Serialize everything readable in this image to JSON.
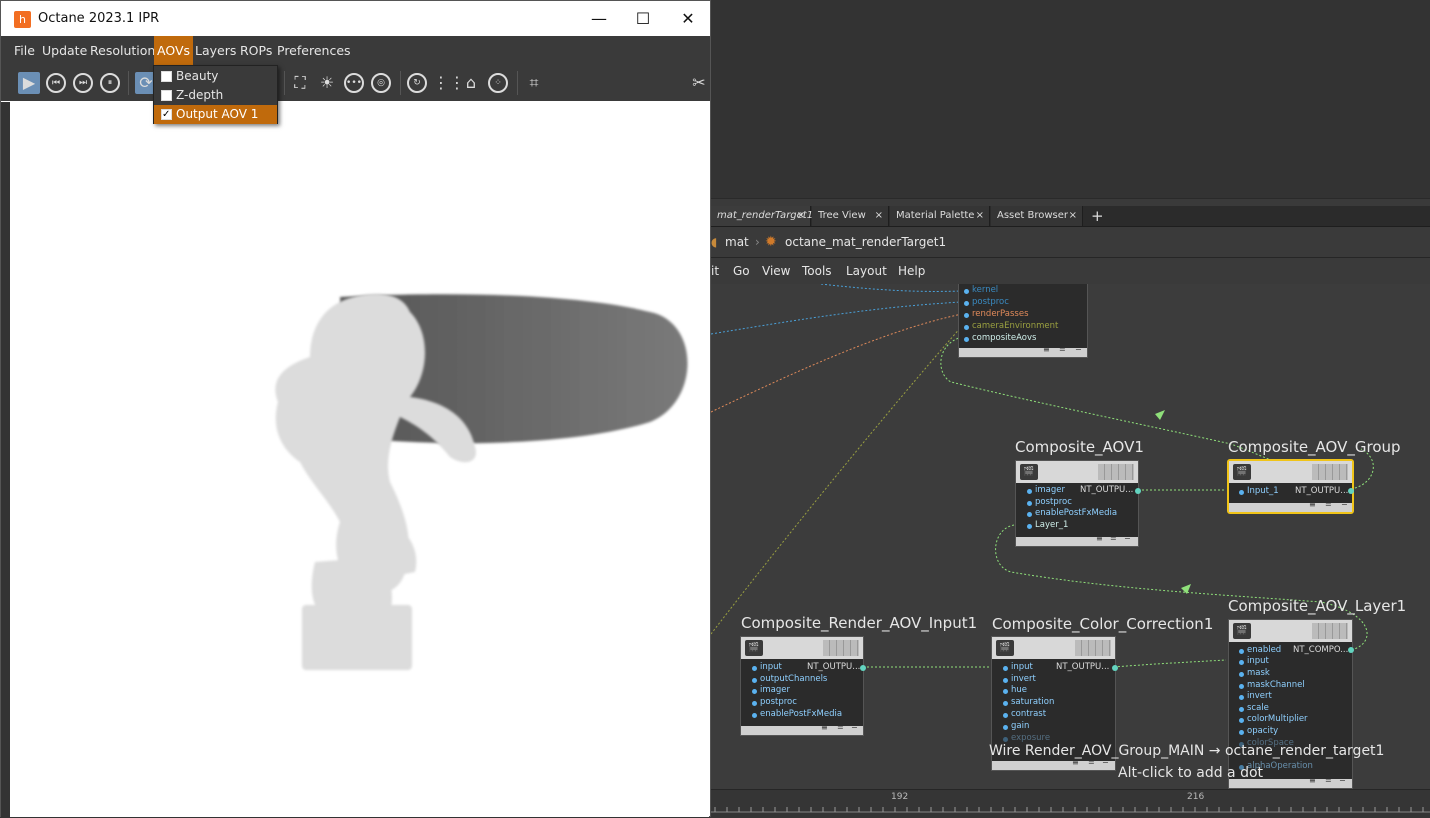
{
  "ipr_window": {
    "title": "Octane 2023.1 IPR",
    "logo_glyph": "h",
    "controls": {
      "minimize": "—",
      "maximize": "☐",
      "close": "✕"
    },
    "menu": [
      "File",
      "Update",
      "Resolution",
      "AOVs",
      "Layers",
      "ROPs",
      "Preferences"
    ],
    "active_menu": "AOVs",
    "aov_menu_items": [
      {
        "label": "Beauty",
        "checked": false
      },
      {
        "label": "Z-depth",
        "checked": false
      },
      {
        "label": "Output AOV 1",
        "checked": true
      }
    ],
    "toolbar_icons": [
      "render-icon",
      "first-frame-icon",
      "next-frame-icon",
      "pause-icon",
      "refresh-icon",
      "focus-picker-icon",
      "light-icon",
      "more-icon",
      "target-icon",
      "spin-icon",
      "grid-icon",
      "home-icon",
      "noise-icon",
      "crop-icon",
      "tools-icon"
    ]
  },
  "houdini": {
    "tabs": [
      {
        "label": "mat_renderTarget1",
        "active": true
      },
      {
        "label": "Tree View",
        "active": false
      },
      {
        "label": "Material Palette",
        "active": false
      },
      {
        "label": "Asset Browser",
        "active": false
      }
    ],
    "tab_add": "+",
    "tab_close": "×",
    "breadcrumb": [
      "mat",
      "octane_mat_renderTarget1"
    ],
    "menu": [
      "it",
      "Go",
      "View",
      "Tools",
      "Layout",
      "Help"
    ],
    "ruler_labels": [
      "192",
      "216"
    ],
    "hint_line1": "Wire Render_AOV_Group_MAIN → octane_render_target1",
    "hint_line2": "Alt-click to add a dot"
  },
  "nodes": {
    "render_target": {
      "ports": [
        "kernel",
        "postproc",
        "renderPasses",
        "cameraEnvironment",
        "compositeAovs"
      ]
    },
    "composite_aov1": {
      "title": "Composite_AOV1",
      "output": "NT_OUTPU...",
      "ports": [
        "imager",
        "postproc",
        "enablePostFxMedia",
        "Layer_1"
      ]
    },
    "composite_aov_group": {
      "title": "Composite_AOV_Group",
      "output": "NT_OUTPU...",
      "ports": [
        "Input_1"
      ]
    },
    "composite_render_aov_input1": {
      "title": "Composite_Render_AOV_Input1",
      "output": "NT_OUTPU...",
      "ports": [
        "input",
        "outputChannels",
        "imager",
        "postproc",
        "enablePostFxMedia"
      ]
    },
    "composite_color_correction1": {
      "title": "Composite_Color_Correction1",
      "output": "NT_OUTPU...",
      "ports": [
        "input",
        "invert",
        "hue",
        "saturation",
        "contrast",
        "gain",
        "exposure"
      ]
    },
    "composite_aov_layer1": {
      "title": "Composite_AOV_Layer1",
      "output": "NT_COMPO...",
      "ports": [
        "enabled",
        "input",
        "mask",
        "maskChannel",
        "invert",
        "scale",
        "colorMultiplier",
        "opacity",
        "colorSpace",
        "alphaOperation"
      ]
    },
    "footer_glyphs": [
      "≡",
      "=",
      "−"
    ]
  },
  "colors": {
    "accent_orange": "#c06a0c",
    "wire_green": "#8fe07a",
    "port_blue": "#5ab2f0",
    "selected_node": "#f0c419"
  }
}
